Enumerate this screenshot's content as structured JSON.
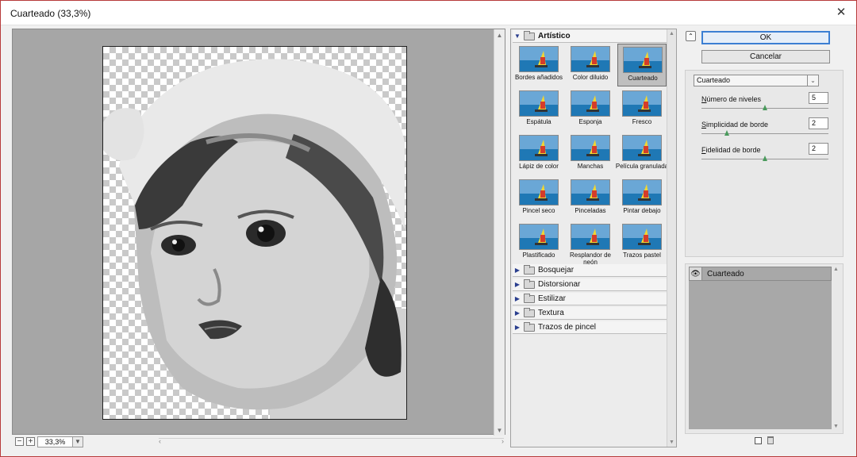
{
  "window": {
    "title": "Cuarteado (33,3%)",
    "close_glyph": "✕"
  },
  "preview": {
    "zoom": "33,3%",
    "zoom_minus": "−",
    "zoom_plus": "+"
  },
  "gallery": {
    "open_category": "Artístico",
    "filters": [
      {
        "label": "Bordes añadidos"
      },
      {
        "label": "Color diluido"
      },
      {
        "label": "Cuarteado",
        "selected": true
      },
      {
        "label": "Espátula"
      },
      {
        "label": "Esponja"
      },
      {
        "label": "Fresco"
      },
      {
        "label": "Lápiz de color"
      },
      {
        "label": "Manchas"
      },
      {
        "label": "Película granulada"
      },
      {
        "label": "Pincel seco"
      },
      {
        "label": "Pinceladas"
      },
      {
        "label": "Pintar debajo"
      },
      {
        "label": "Plastificado"
      },
      {
        "label": "Resplandor de neón"
      },
      {
        "label": "Trazos pastel"
      }
    ],
    "categories": [
      "Bosquejar",
      "Distorsionar",
      "Estilizar",
      "Textura",
      "Trazos de pincel"
    ]
  },
  "buttons": {
    "ok": "OK",
    "cancel": "Cancelar"
  },
  "settings": {
    "filter": "Cuarteado",
    "params": [
      {
        "first": "N",
        "rest": "úmero de niveles",
        "value": "5",
        "level": 0.5
      },
      {
        "first": "S",
        "rest": "implicidad de borde",
        "value": "2",
        "level": 0.2
      },
      {
        "first": "F",
        "rest": "idelidad de borde",
        "value": "2",
        "level": 0.5
      }
    ]
  },
  "layers": {
    "items": [
      "Cuarteado"
    ]
  },
  "colors": {
    "accent": "#3c7fd3",
    "window_border": "#b73a3a"
  }
}
